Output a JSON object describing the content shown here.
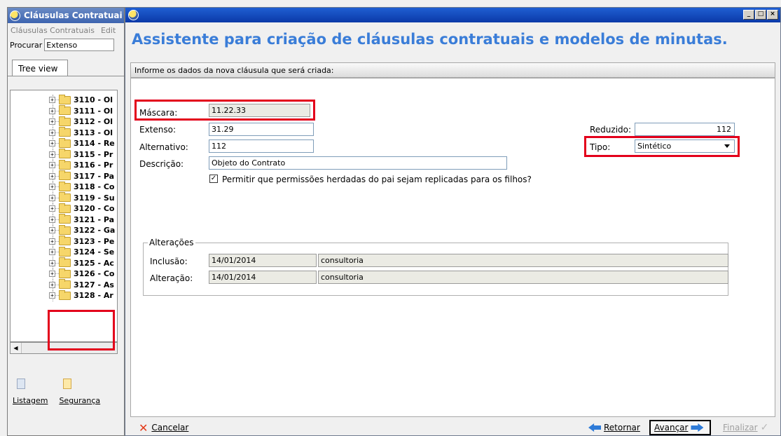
{
  "back_window": {
    "title": "Cláusulas Contratuai",
    "menu": [
      "Cláusulas Contratuais",
      "Edit"
    ],
    "search_label": "Procurar",
    "search_value": "Extenso",
    "tab_label": "Tree view",
    "tree_items": [
      "3110 - Ol",
      "3111 - Ol",
      "3112 - Ol",
      "3113 - Ol",
      "3114 - Re",
      "3115 - Pr",
      "3116 - Pr",
      "3117 - Pa",
      "3118 - Co",
      "3119 - Su",
      "3120 - Co",
      "3121 - Pa",
      "3122 - Ga",
      "3123 - Pe",
      "3124 - Se",
      "3125 - Ac",
      "3126 - Co",
      "3127 - As",
      "3128 - Ar"
    ],
    "actions": [
      "Listagem",
      "Segurança"
    ]
  },
  "dialog": {
    "heading": "Assistente para criação de cláusulas contratuais e modelos de minutas.",
    "subheader": "Informe os dados da nova cláusula que será criada:",
    "window_buttons": [
      "_",
      "□",
      "×"
    ],
    "form": {
      "mascara_label": "Máscara:",
      "mascara_value": "11.22.33",
      "extenso_label": "Extenso:",
      "extenso_value": "31.29",
      "alternativo_label": "Alternativo:",
      "alternativo_value": "112",
      "descricao_label": "Descrição:",
      "descricao_value": "Objeto do Contrato",
      "reduzido_label": "Reduzido:",
      "reduzido_value": "112",
      "tipo_label": "Tipo:",
      "tipo_value": "Sintético",
      "checkbox_label": "Permitir que permissões herdadas do pai sejam replicadas para os filhos?",
      "checkbox_checked": true
    },
    "alteracoes": {
      "legend": "Alterações",
      "inclusao_label": "Inclusão:",
      "inclusao_date": "14/01/2014",
      "inclusao_user": "consultoria",
      "alteracao_label": "Alteração:",
      "alteracao_date": "14/01/2014",
      "alteracao_user": "consultoria"
    },
    "buttons": {
      "cancelar": "Cancelar",
      "retornar": "Retornar",
      "avancar": "Avançar",
      "finalizar": "Finalizar"
    }
  },
  "colors": {
    "highlight": "#e3001b",
    "heading": "#3a7dd8",
    "titlebar": "#0b39a8"
  }
}
